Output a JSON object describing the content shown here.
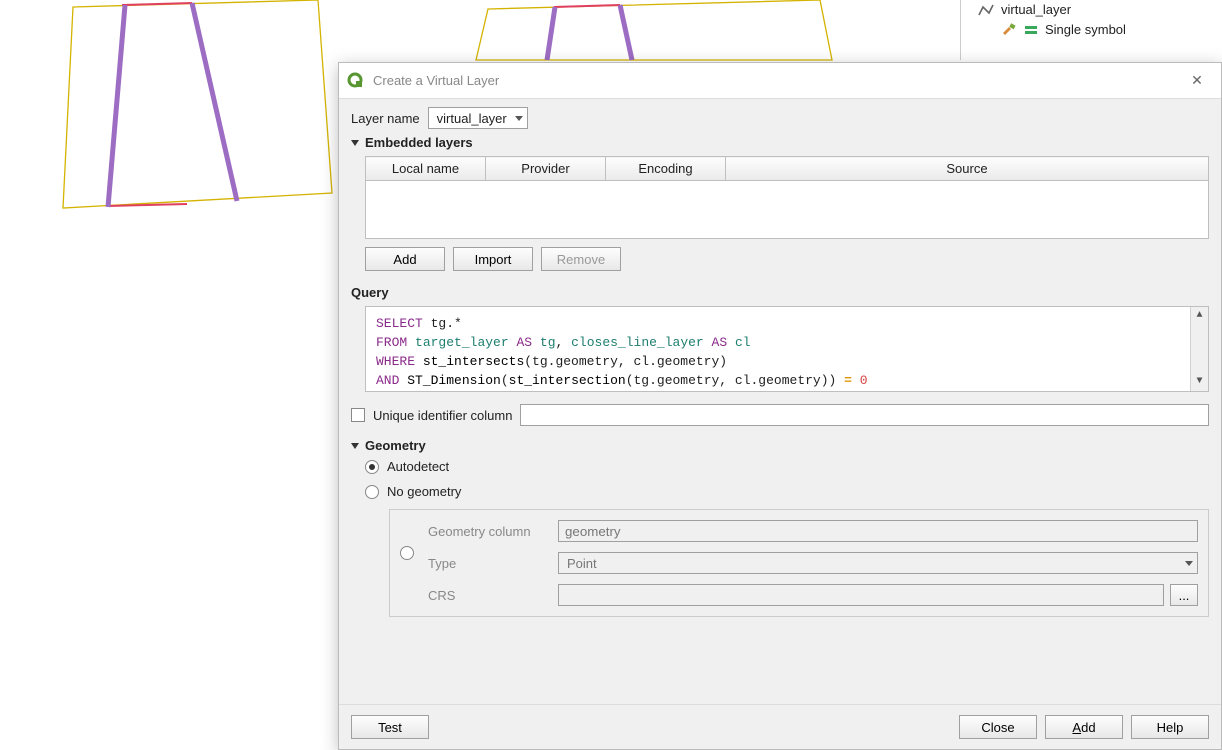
{
  "layers_panel": {
    "layer_name": "virtual_layer",
    "style_label": "Single symbol"
  },
  "dialog": {
    "title": "Create a Virtual Layer",
    "layer_name_label": "Layer name",
    "layer_name_value": "virtual_layer",
    "embedded": {
      "header": "Embedded layers",
      "columns": [
        "Local name",
        "Provider",
        "Encoding",
        "Source"
      ],
      "buttons": {
        "add": "Add",
        "import": "Import",
        "remove": "Remove"
      }
    },
    "query": {
      "header": "Query",
      "sql": {
        "line1": {
          "select": "SELECT",
          "rest": " tg.*"
        },
        "line2": {
          "from": "FROM",
          "t1": "target_layer",
          "as1": "AS",
          "a1": "tg",
          "comma": ", ",
          "t2": "closes_line_layer",
          "as2": "AS",
          "a2": "cl"
        },
        "line3": {
          "where": "WHERE",
          "fn": "st_intersects",
          "args": "(tg.geometry, cl.geometry)"
        },
        "line4": {
          "and": "AND",
          "fn": "ST_Dimension",
          "open": "(",
          "fn2": "st_intersection",
          "args": "(tg.geometry, cl.geometry)",
          "close": ")",
          "eq": " = ",
          "zero": "0"
        }
      }
    },
    "uic": {
      "label": "Unique identifier column",
      "value": ""
    },
    "geometry": {
      "header": "Geometry",
      "autodetect": "Autodetect",
      "nogeom": "No geometry",
      "col_label": "Geometry column",
      "col_value": "geometry",
      "type_label": "Type",
      "type_value": "Point",
      "crs_label": "CRS",
      "crs_value": ""
    },
    "footer": {
      "test": "Test",
      "close": "Close",
      "add": "Add",
      "help": "Help"
    }
  }
}
